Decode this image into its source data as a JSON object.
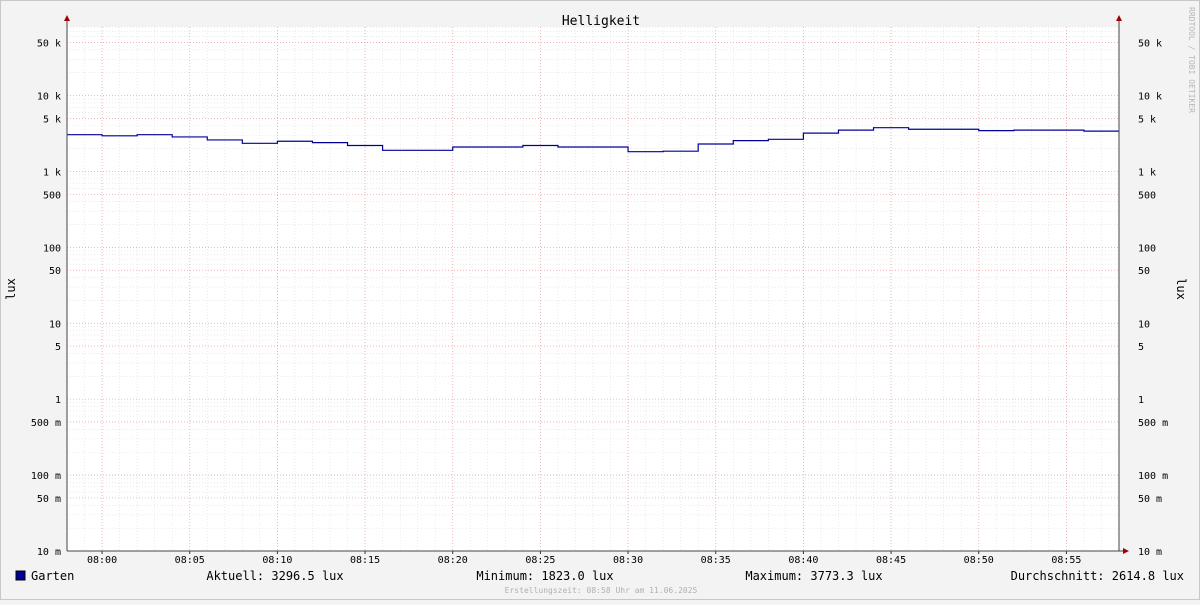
{
  "chart_data": {
    "type": "line",
    "title": "Helligkeit",
    "ylabel": "lux",
    "ylabel_right": "lux",
    "yscale": "log",
    "ylim": [
      0.01,
      80000
    ],
    "xlim": [
      "07:58",
      "08:58"
    ],
    "x_ticks": [
      "08:00",
      "08:05",
      "08:10",
      "08:15",
      "08:20",
      "08:25",
      "08:30",
      "08:35",
      "08:40",
      "08:45",
      "08:50",
      "08:55"
    ],
    "y_ticks": [
      {
        "value": 50000,
        "label": "50 k"
      },
      {
        "value": 10000,
        "label": "10 k"
      },
      {
        "value": 5000,
        "label": "5 k"
      },
      {
        "value": 1000,
        "label": "1 k"
      },
      {
        "value": 500,
        "label": "500"
      },
      {
        "value": 100,
        "label": "100"
      },
      {
        "value": 50,
        "label": "50"
      },
      {
        "value": 10,
        "label": "10"
      },
      {
        "value": 5,
        "label": "5"
      },
      {
        "value": 1,
        "label": "1"
      },
      {
        "value": 0.5,
        "label": "500 m"
      },
      {
        "value": 0.1,
        "label": "100 m"
      },
      {
        "value": 0.05,
        "label": "50 m"
      },
      {
        "value": 0.01,
        "label": "10 m"
      }
    ],
    "grid": true,
    "series": [
      {
        "name": "Garten",
        "color": "#000099",
        "x": [
          "07:58",
          "08:00",
          "08:02",
          "08:04",
          "08:06",
          "08:08",
          "08:10",
          "08:12",
          "08:14",
          "08:16",
          "08:18",
          "08:20",
          "08:22",
          "08:24",
          "08:26",
          "08:28",
          "08:30",
          "08:32",
          "08:34",
          "08:36",
          "08:38",
          "08:40",
          "08:42",
          "08:44",
          "08:46",
          "08:48",
          "08:50",
          "08:52",
          "08:54",
          "08:56",
          "08:58"
        ],
        "y": [
          3050,
          2950,
          3050,
          2850,
          2600,
          2350,
          2500,
          2400,
          2200,
          1900,
          1900,
          2100,
          2100,
          2200,
          2100,
          2100,
          1823,
          1850,
          2300,
          2550,
          2650,
          3200,
          3500,
          3773,
          3600,
          3600,
          3450,
          3500,
          3500,
          3400,
          3296
        ]
      }
    ],
    "legend": {
      "position": "bottom",
      "series_label": "Garten",
      "series_color": "#000099",
      "stats": [
        "Aktuell: 3296.5 lux",
        "Minimum: 1823.0 lux",
        "Maximum: 3773.3 lux",
        "Durchschnitt: 2614.8 lux"
      ]
    },
    "watermark": "RRDTOOL / TOBI OETIKER",
    "footer": "Erstellungszeit: 08:58 Uhr am 11.06.2025"
  }
}
